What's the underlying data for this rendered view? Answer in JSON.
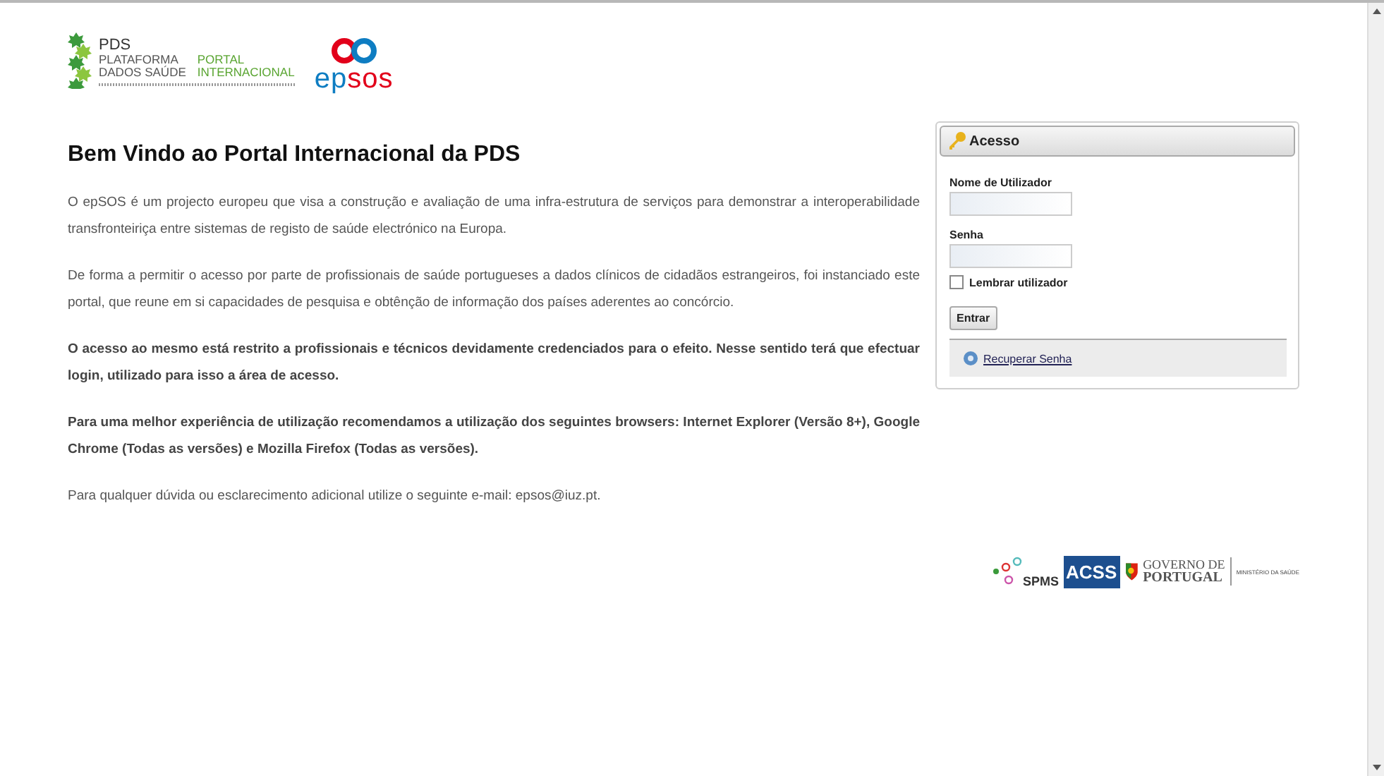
{
  "header": {
    "pds_logo": {
      "title": "PDS",
      "line_1": "PLATAFORMA",
      "line_2": "DADOS SAÚDE",
      "portal_1": "PORTAL",
      "portal_2": "INTERNACIONAL"
    },
    "epsos_logo": {
      "text_1": "ep",
      "text_2": "sos"
    }
  },
  "heading": "Bem Vindo ao Portal Internacional da PDS",
  "paragraphs": [
    {
      "text": "O epSOS é um projecto europeu que visa a construção e avaliação de uma infra-estrutura de serviços para demonstrar a interoperabilidade transfronteiriça entre sistemas de registo de saúde electrónico na Europa.",
      "bold": false
    },
    {
      "text": "De forma a permitir o acesso por parte de profissionais de saúde portugueses a dados clínicos de cidadãos estrangeiros, foi instanciado este portal, que reune em si capacidades de pesquisa e obtênção de informação dos países aderentes ao concórcio.",
      "bold": false
    },
    {
      "text": "O acesso ao mesmo está restrito a profissionais e técnicos devidamente credenciados para o efeito. Nesse sentido terá que efectuar login, utilizado para isso a área de acesso.",
      "bold": true
    },
    {
      "text": "Para uma melhor experiência de utilização recomendamos a utilização dos seguintes browsers: Internet Explorer (Versão 8+), Google Chrome (Todas as versões) e Mozilla Firefox (Todas as versões).",
      "bold": true
    },
    {
      "text": "Para qualquer dúvida ou esclarecimento adicional utilize o seguinte e-mail: epsos@iuz.pt.",
      "bold": false
    }
  ],
  "login": {
    "title": "Acesso",
    "username_label": "Nome de Utilizador",
    "password_label": "Senha",
    "remember": {
      "label": "Lembrar utilizador",
      "checked": false
    },
    "submit": "Entrar",
    "recover_link": "Recuperar Senha"
  },
  "footer_logos": {
    "spms": "SPMS",
    "acss": "ACSS",
    "governo_1": "GOVERNO DE",
    "governo_2": "PORTUGAL",
    "ministerio": "MINISTÉRIO DA SAÚDE"
  }
}
